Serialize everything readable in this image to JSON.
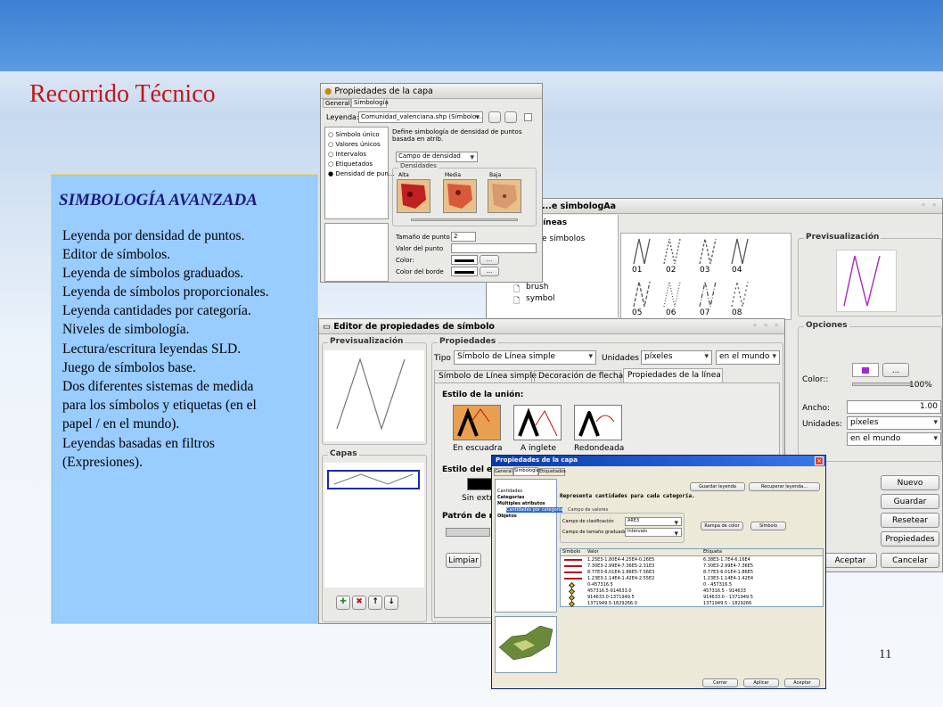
{
  "slide": {
    "title": "Recorrido Técnico",
    "page_number": "11"
  },
  "left_panel": {
    "heading": "SIMBOLOGÍA AVANZADA",
    "lines": [
      "Leyenda por densidad de puntos.",
      "Editor de símbolos.",
      "Leyenda de símbolos graduados.",
      "Leyenda de símbolos proporcionales.",
      "Leyenda cantidades por categoría.",
      "Niveles de simbología.",
      "Lectura/escritura leyendas SLD.",
      "Juego de símbolos base.",
      "Dos diferentes sistemas de medida",
      "para los símbolos y etiquetas (en el",
      "papel / en el mundo).",
      "Leyendas basadas en filtros",
      "(Expresiones)."
    ]
  },
  "win_layer_props": {
    "title": "Propiedades de la capa",
    "tabs": [
      "General",
      "Simbología"
    ],
    "legend_label": "Leyenda:",
    "legend_value": "Comunidad_valenciana.shp (Símbolo ...",
    "options": [
      "Símbolo único",
      "Valores únicos",
      "Intervalos",
      "Etiquetados",
      "Densidad de pun..."
    ],
    "description": "Define simbología de densidad de puntos basada en atrib.",
    "density_field_label": "Campo de densidad",
    "densities_label": "Densidades",
    "density_levels": [
      "Alta",
      "Media",
      "Baja"
    ],
    "point_size_label": "Tamaño de punto",
    "point_size_value": "2",
    "point_value_label": "Valor del punto",
    "color_label": "Color:",
    "border_color_label": "Color del borde",
    "browse": "..."
  },
  "win_symbol_library": {
    "title": "...e simbologAa",
    "tree_header": "líneas",
    "tree_items": [
      "e símbolos",
      "brush",
      "symbol"
    ],
    "symbol_labels": [
      "01",
      "02",
      "03",
      "04",
      "05",
      "06",
      "07",
      "08"
    ],
    "preview_label": "Previsualización",
    "options_label": "Opciones",
    "color_label": "Color::",
    "color_btn": "...",
    "alpha": "100%",
    "width_label": "Ancho:",
    "width_value": "1.00",
    "units_label": "Unidades:",
    "units_value": "píxeles",
    "ref_value": "en el mundo",
    "buttons": [
      "Nuevo",
      "Guardar",
      "Resetear",
      "Propiedades"
    ],
    "accept": "Aceptar",
    "cancel": "Cancelar"
  },
  "win_symbol_editor": {
    "title": "Editor de propiedades de símbolo",
    "preview_label": "Previsualización",
    "props_label": "Propiedades",
    "type_label": "Tipo",
    "type_value": "Símbolo de Línea simple",
    "units_label": "Unidades",
    "units_value": "píxeles",
    "ref_value": "en el mundo",
    "tabs": [
      "Símbolo de Línea simple",
      "Decoración de flecha",
      "Propiedades de la línea"
    ],
    "join_label": "Estilo de la unión:",
    "join_options": [
      "En escuadra",
      "A inglete",
      "Redondeada"
    ],
    "end_label": "Estilo del e",
    "end_value": "Sin extr",
    "pattern_label": "Patrón de re",
    "clear": "Limpiar",
    "layers_label": "Capas"
  },
  "win_categories": {
    "title": "Propiedades de la capa",
    "tabs": [
      "General",
      "Simbología",
      "Etiquetados"
    ],
    "tree": [
      "Cantidades",
      "Categorías",
      "Múltiples atributos",
      "Cantidades por categoría",
      "Objetos"
    ],
    "save_legend": "Guardar leyenda",
    "load_legend": "Recuperar leyenda...",
    "description": "Representa cantidades para cada categoría.",
    "values_field_label": "Campo de valores",
    "color_field_label": "Campo de clasificación",
    "graduated_label": "Campo de tamaño graduado",
    "field_value_1": "ARE3",
    "field_value_2": "Intervalo",
    "color_ramp": "Rampa de color",
    "symbol_btn": "Símbolo",
    "col_symbol": "Símbolo",
    "col_value": "Valor",
    "col_label": "Etiqueta",
    "rows": [
      [
        "1.25E3-1.80E4-4.25E4-0.26E5",
        "6.38E3-1.7E4-6.16E4"
      ],
      [
        "7.30E3-2.99E4-7.36E5-2.31E3",
        "7.30E3-2.99E4-7.36E5"
      ],
      [
        "8.77E3-6.01E4-1.86E5-7.56E3",
        "8.77E3-6.01E4-1.86E5"
      ],
      [
        "1.23E3-1.14E4-1.42E4-2.55E2",
        "1.23E3-1.14E4-1.42E4"
      ],
      [
        "0-457316.5",
        "0 - 457316.5"
      ],
      [
        "457316.5-914633.0",
        "457316.5 - 914633"
      ],
      [
        "914633.0-1371949.5",
        "914633.0 - 1371949.5"
      ],
      [
        "1371949.5-1829266.0",
        "1371949.5 - 1829266"
      ]
    ],
    "close": "Cerrar",
    "apply": "Aplicar",
    "accept": "Aceptar"
  }
}
